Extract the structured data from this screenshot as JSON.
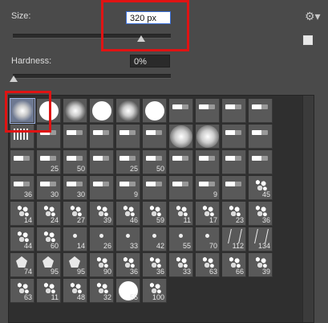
{
  "size": {
    "label": "Size:",
    "value": "320 px"
  },
  "hardness": {
    "label": "Hardness:",
    "value": "0%"
  },
  "menu_icon": "gear-icon",
  "new_preset_icon": "new-preset-icon",
  "brushes": [
    {
      "label": "",
      "kind": "soft"
    },
    {
      "label": "",
      "kind": "hard"
    },
    {
      "label": "",
      "kind": "soft"
    },
    {
      "label": "",
      "kind": "hard"
    },
    {
      "label": "",
      "kind": "soft"
    },
    {
      "label": "",
      "kind": "hard"
    },
    {
      "label": "",
      "kind": "tip"
    },
    {
      "label": "",
      "kind": "tip"
    },
    {
      "label": "",
      "kind": "tip"
    },
    {
      "label": "",
      "kind": "tip"
    },
    {
      "label": "",
      "kind": "fan"
    },
    {
      "label": "",
      "kind": "tip"
    },
    {
      "label": "",
      "kind": "tip"
    },
    {
      "label": "",
      "kind": "tip"
    },
    {
      "label": "",
      "kind": "tip"
    },
    {
      "label": "",
      "kind": "tip"
    },
    {
      "label": "",
      "kind": "bigsoft"
    },
    {
      "label": "",
      "kind": "bigsoft"
    },
    {
      "label": "",
      "kind": "tip"
    },
    {
      "label": "",
      "kind": "tip"
    },
    {
      "label": "",
      "kind": "tip"
    },
    {
      "label": "25",
      "kind": "tip"
    },
    {
      "label": "50",
      "kind": "tip"
    },
    {
      "label": "",
      "kind": "tip"
    },
    {
      "label": "25",
      "kind": "tip"
    },
    {
      "label": "50",
      "kind": "tip"
    },
    {
      "label": "",
      "kind": "tip"
    },
    {
      "label": "",
      "kind": "tip"
    },
    {
      "label": "",
      "kind": "tip"
    },
    {
      "label": "",
      "kind": "tip"
    },
    {
      "label": "36",
      "kind": "tip"
    },
    {
      "label": "30",
      "kind": "tip"
    },
    {
      "label": "30",
      "kind": "tip"
    },
    {
      "label": "",
      "kind": "tip"
    },
    {
      "label": "9",
      "kind": "tip"
    },
    {
      "label": "",
      "kind": "tip"
    },
    {
      "label": "",
      "kind": "tip"
    },
    {
      "label": "9",
      "kind": "tip"
    },
    {
      "label": "",
      "kind": "tip"
    },
    {
      "label": "45",
      "kind": "splat"
    },
    {
      "label": "14",
      "kind": "splat"
    },
    {
      "label": "24",
      "kind": "splat"
    },
    {
      "label": "27",
      "kind": "splat"
    },
    {
      "label": "39",
      "kind": "splat"
    },
    {
      "label": "46",
      "kind": "splat"
    },
    {
      "label": "59",
      "kind": "splat"
    },
    {
      "label": "11",
      "kind": "splat"
    },
    {
      "label": "17",
      "kind": "splat"
    },
    {
      "label": "23",
      "kind": "splat"
    },
    {
      "label": "36",
      "kind": "splat"
    },
    {
      "label": "44",
      "kind": "splat"
    },
    {
      "label": "60",
      "kind": "splat"
    },
    {
      "label": "14",
      "kind": "dot"
    },
    {
      "label": "26",
      "kind": "dot"
    },
    {
      "label": "33",
      "kind": "dot"
    },
    {
      "label": "42",
      "kind": "dot"
    },
    {
      "label": "55",
      "kind": "dot"
    },
    {
      "label": "70",
      "kind": "dot"
    },
    {
      "label": "112",
      "kind": "grass"
    },
    {
      "label": "134",
      "kind": "grass"
    },
    {
      "label": "74",
      "kind": "leaf"
    },
    {
      "label": "95",
      "kind": "leaf"
    },
    {
      "label": "95",
      "kind": "leaf"
    },
    {
      "label": "90",
      "kind": "splat"
    },
    {
      "label": "36",
      "kind": "splat"
    },
    {
      "label": "36",
      "kind": "splat"
    },
    {
      "label": "33",
      "kind": "splat"
    },
    {
      "label": "63",
      "kind": "splat"
    },
    {
      "label": "66",
      "kind": "splat"
    },
    {
      "label": "39",
      "kind": "splat"
    },
    {
      "label": "63",
      "kind": "splat"
    },
    {
      "label": "11",
      "kind": "splat"
    },
    {
      "label": "48",
      "kind": "splat"
    },
    {
      "label": "32",
      "kind": "splat"
    },
    {
      "label": "55",
      "kind": "hard"
    },
    {
      "label": "100",
      "kind": "splat"
    }
  ]
}
